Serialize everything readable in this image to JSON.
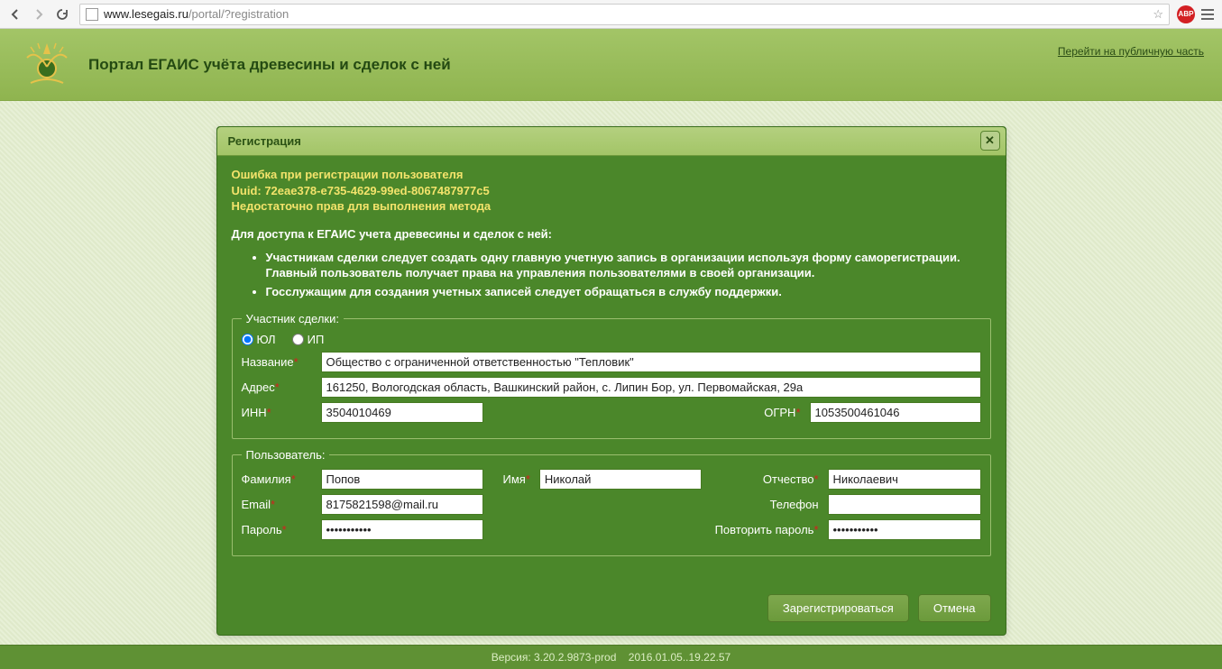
{
  "browser": {
    "url_host": "www.lesegais.ru",
    "url_path": "/portal/?registration",
    "abp": "ABP"
  },
  "header": {
    "title": "Портал ЕГАИС учёта древесины и сделок с ней",
    "public_link": "Перейти на публичную часть"
  },
  "dialog": {
    "title": "Регистрация",
    "error_l1": "Ошибка при регистрации пользователя",
    "error_l2": "Uuid: 72eae378-e735-4629-99ed-8067487977c5",
    "error_l3": "Недостаточно прав для выполнения метода",
    "intro": "Для доступа к ЕГАИС учета древесины и сделок с ней:",
    "bullet1": "Участникам сделки следует создать одну главную учетную запись в организации используя форму саморегистрации. Главный пользователь получает права на управления пользователями в своей организации.",
    "bullet2": "Госслужащим для создания учетных записей следует обращаться в службу поддержки.",
    "fs1_legend": "Участник сделки:",
    "radio_ul": "ЮЛ",
    "radio_ip": "ИП",
    "lbl_name": "Название",
    "val_name": "Общество с ограниченной ответственностью \"Тепловик\"",
    "lbl_addr": "Адрес",
    "val_addr": "161250, Вологодская область, Вашкинский район, с. Липин Бор, ул. Первомайская, 29а",
    "lbl_inn": "ИНН",
    "val_inn": "3504010469",
    "lbl_ogrn": "ОГРН",
    "val_ogrn": "1053500461046",
    "fs2_legend": "Пользователь:",
    "lbl_lastname": "Фамилия",
    "val_lastname": "Попов",
    "lbl_firstname": "Имя",
    "val_firstname": "Николай",
    "lbl_patronymic": "Отчество",
    "val_patronymic": "Николаевич",
    "lbl_email": "Email",
    "val_email": "8175821598@mail.ru",
    "lbl_phone": "Телефон",
    "val_phone": "",
    "lbl_pass": "Пароль",
    "val_pass": "•••••••••••",
    "lbl_pass2": "Повторить пароль",
    "val_pass2": "•••••••••••",
    "btn_register": "Зарегистрироваться",
    "btn_cancel": "Отмена"
  },
  "footer": {
    "version": "Версия: 3.20.2.9873-prod",
    "date": "2016.01.05..19.22.57"
  }
}
